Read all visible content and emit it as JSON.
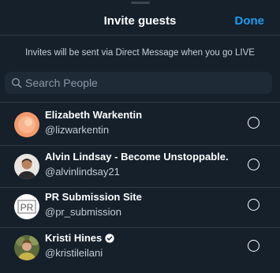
{
  "header": {
    "title": "Invite guests",
    "done_label": "Done"
  },
  "note": "Invites will be sent via Direct Message when you go LIVE",
  "search": {
    "placeholder": "Search People",
    "icon": "search-icon"
  },
  "guests": [
    {
      "name": "Elizabeth Warkentin",
      "handle": "@lizwarkentin",
      "verified": false
    },
    {
      "name": "Alvin Lindsay - Become Unstoppable.",
      "handle": "@alvinlindsay21",
      "verified": false
    },
    {
      "name": "PR Submission Site",
      "handle": "@pr_submission",
      "verified": false,
      "avatar_text": "PR"
    },
    {
      "name": "Kristi Hines",
      "handle": "@kristileilani",
      "verified": true
    }
  ],
  "colors": {
    "background": "#15202b",
    "accent": "#1d9bf0",
    "search_bg": "#1e2a36",
    "divider": "#2f3b47"
  }
}
